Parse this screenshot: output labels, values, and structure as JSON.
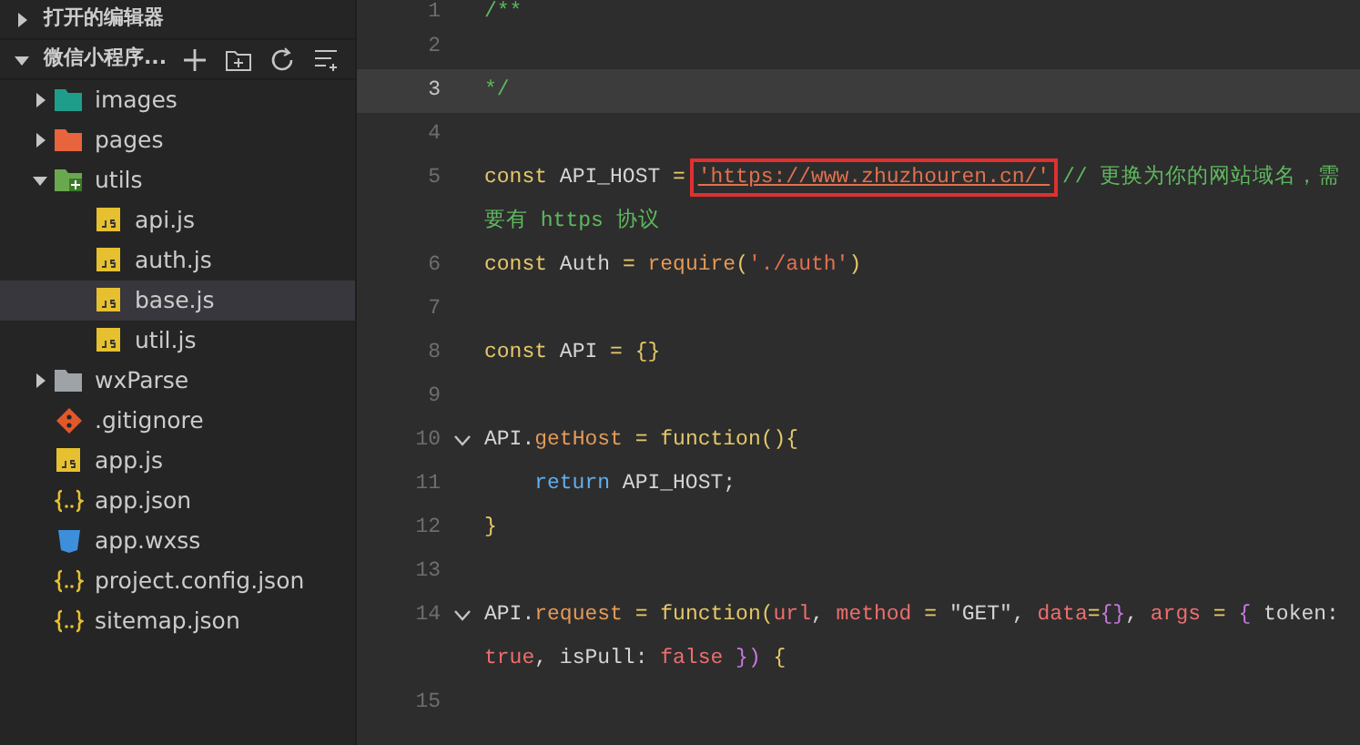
{
  "sidebar": {
    "sections": [
      {
        "title": "打开的编辑器",
        "expanded": false
      },
      {
        "title": "微信小程序...",
        "expanded": true
      }
    ],
    "tree": [
      {
        "label": "images",
        "kind": "folder",
        "color": "#1e9e8a",
        "expanded": false,
        "selected": false
      },
      {
        "label": "pages",
        "kind": "folder",
        "color": "#e8643c",
        "expanded": false,
        "selected": false
      },
      {
        "label": "utils",
        "kind": "folder",
        "color": "#6aa84f",
        "expanded": true,
        "selected": false,
        "children": [
          {
            "label": "api.js",
            "kind": "js",
            "selected": false
          },
          {
            "label": "auth.js",
            "kind": "js",
            "selected": false
          },
          {
            "label": "base.js",
            "kind": "js",
            "selected": true
          },
          {
            "label": "util.js",
            "kind": "js",
            "selected": false
          }
        ]
      },
      {
        "label": "wxParse",
        "kind": "folder",
        "color": "#9ea3a8",
        "expanded": false,
        "selected": false
      },
      {
        "label": ".gitignore",
        "kind": "git",
        "selected": false
      },
      {
        "label": "app.js",
        "kind": "js",
        "selected": false
      },
      {
        "label": "app.json",
        "kind": "json",
        "selected": false
      },
      {
        "label": "app.wxss",
        "kind": "css",
        "selected": false
      },
      {
        "label": "project.config.json",
        "kind": "json",
        "selected": false
      },
      {
        "label": "sitemap.json",
        "kind": "json",
        "selected": false
      }
    ]
  },
  "editor": {
    "lines": [
      {
        "number": "1",
        "current": false,
        "fold": false,
        "tokens": [
          {
            "text": "/**",
            "kind": "comment"
          }
        ]
      },
      {
        "number": "2",
        "current": false,
        "fold": false
      },
      {
        "number": "3",
        "current": true,
        "fold": false,
        "tokens": [
          {
            "text": "*/",
            "kind": "comment"
          }
        ]
      },
      {
        "number": "4",
        "current": false,
        "fold": false
      },
      {
        "number": "5",
        "current": false,
        "fold": false,
        "tokens": [
          {
            "text": "const",
            "kind": "keyword"
          },
          {
            "text": " API_HOST ",
            "kind": "name"
          },
          {
            "text": "= ",
            "kind": "operator"
          },
          {
            "text": "'https://www.zhuzhouren.cn/'",
            "kind": "link",
            "boxed": true
          },
          {
            "text": " // 更换为你的网站域名，需",
            "kind": "comment"
          }
        ]
      },
      {
        "current": false,
        "fold": false,
        "tokens": [
          {
            "text": "要有 https 协议",
            "kind": "comment"
          }
        ]
      },
      {
        "number": "6",
        "current": false,
        "fold": false,
        "tokens": [
          {
            "text": "const",
            "kind": "keyword"
          },
          {
            "text": " Auth ",
            "kind": "name"
          },
          {
            "text": "= ",
            "kind": "operator"
          },
          {
            "text": "require",
            "kind": "property"
          },
          {
            "text": "(",
            "kind": "operator"
          },
          {
            "text": "'./auth'",
            "kind": "string"
          },
          {
            "text": ")",
            "kind": "operator"
          }
        ]
      },
      {
        "number": "7",
        "current": false,
        "fold": false
      },
      {
        "number": "8",
        "current": false,
        "fold": false,
        "tokens": [
          {
            "text": "const",
            "kind": "keyword"
          },
          {
            "text": " API ",
            "kind": "name"
          },
          {
            "text": "= {}",
            "kind": "operator"
          }
        ]
      },
      {
        "number": "9",
        "current": false,
        "fold": false
      },
      {
        "number": "10",
        "current": false,
        "fold": true,
        "tokens": [
          {
            "text": "API.",
            "kind": "name"
          },
          {
            "text": "getHost",
            "kind": "property"
          },
          {
            "text": " = ",
            "kind": "operator"
          },
          {
            "text": "function(){",
            "kind": "keyword"
          }
        ]
      },
      {
        "number": "11",
        "current": false,
        "fold": false,
        "tokens": [
          {
            "text": "    return",
            "kind": "control"
          },
          {
            "text": " API_HOST;",
            "kind": "name"
          }
        ]
      },
      {
        "number": "12",
        "current": false,
        "fold": false,
        "tokens": [
          {
            "text": "}",
            "kind": "operator"
          }
        ]
      },
      {
        "number": "13",
        "current": false,
        "fold": false
      },
      {
        "number": "14",
        "current": false,
        "fold": true,
        "tokens": [
          {
            "text": "API.",
            "kind": "name"
          },
          {
            "text": "request",
            "kind": "property"
          },
          {
            "text": " = ",
            "kind": "operator"
          },
          {
            "text": "function(",
            "kind": "keyword"
          },
          {
            "text": "url",
            "kind": "param"
          },
          {
            "text": ", ",
            "kind": "name"
          },
          {
            "text": "method",
            "kind": "param"
          },
          {
            "text": " = ",
            "kind": "operator"
          },
          {
            "text": "\"GET\", ",
            "kind": "name"
          },
          {
            "text": "data",
            "kind": "param"
          },
          {
            "text": "=",
            "kind": "operator"
          },
          {
            "text": "{}",
            "kind": "brace"
          },
          {
            "text": ", ",
            "kind": "name"
          },
          {
            "text": "args",
            "kind": "param"
          },
          {
            "text": " = ",
            "kind": "operator"
          },
          {
            "text": "{",
            "kind": "brace"
          },
          {
            "text": " token:",
            "kind": "name"
          }
        ]
      },
      {
        "current": false,
        "fold": false,
        "tokens": [
          {
            "text": "true",
            "kind": "param"
          },
          {
            "text": ", isPull: ",
            "kind": "name"
          },
          {
            "text": "false",
            "kind": "param"
          },
          {
            "text": " })",
            "kind": "brace"
          },
          {
            "text": " {",
            "kind": "operator"
          }
        ]
      },
      {
        "number": "15",
        "current": false,
        "fold": false
      }
    ]
  }
}
